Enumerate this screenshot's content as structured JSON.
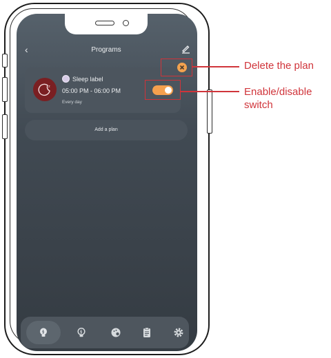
{
  "header": {
    "back_glyph": "‹",
    "title": "Programs",
    "edit_icon": "pencil-edit-icon"
  },
  "plan": {
    "label": "Sleep label",
    "time": "05:00 PM - 06:00 PM",
    "repeat": "Every day",
    "enabled": true,
    "icon": "moon-sleep-icon",
    "icon_color": "#7a1f22",
    "toggle_color": "#f5a04e",
    "delete_color": "#f2a24f"
  },
  "actions": {
    "add_plan_label": "Add a plan"
  },
  "annotations": {
    "delete_label": "Delete the plan",
    "switch_label": "Enable/disable\nswitch",
    "color": "#d0343a"
  },
  "tabs": [
    {
      "icon": "bulb-icon",
      "active": true
    },
    {
      "icon": "bulb-outline-icon",
      "active": false
    },
    {
      "icon": "palette-icon",
      "active": false
    },
    {
      "icon": "clipboard-icon",
      "active": false
    },
    {
      "icon": "gear-icon",
      "active": false
    }
  ]
}
